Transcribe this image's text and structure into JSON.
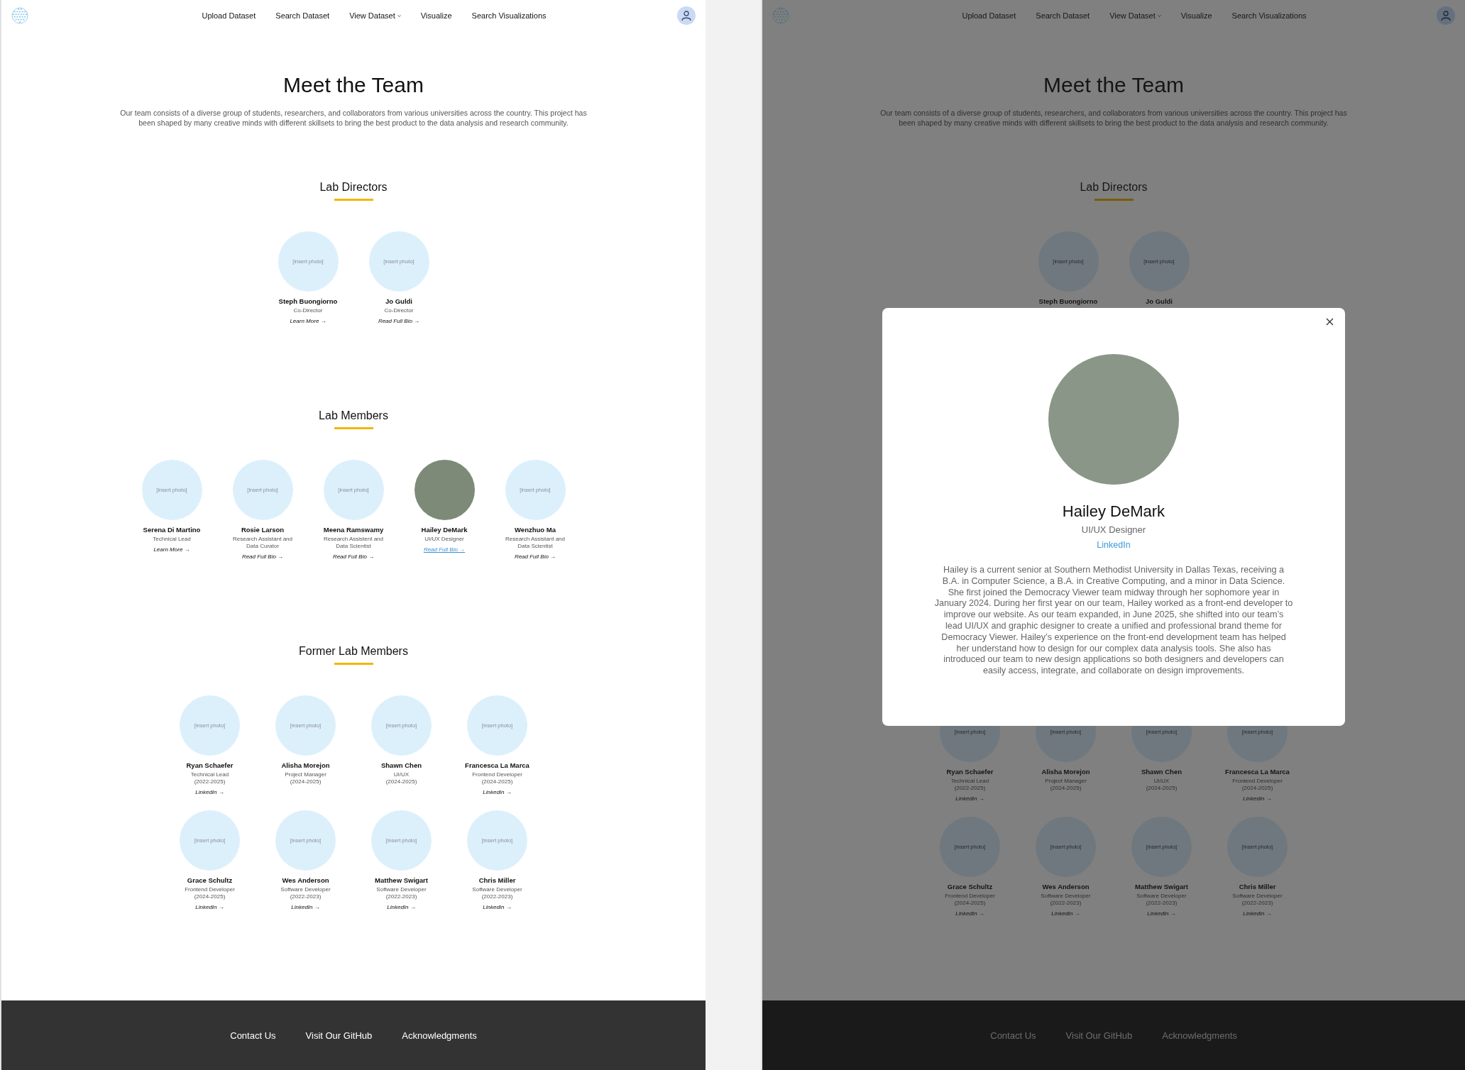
{
  "frames": [
    {
      "nav": {
        "links": [
          {
            "label": "Upload Dataset",
            "dropdown": false
          },
          {
            "label": "Search Dataset",
            "dropdown": false
          },
          {
            "label": "View Dataset",
            "dropdown": true
          },
          {
            "label": "Visualize",
            "dropdown": false
          },
          {
            "label": "Search Visualizations",
            "dropdown": false
          }
        ]
      },
      "title": "Meet the Team",
      "intro": "Our team consists of a diverse group of students, researchers, and collaborators from various universities across the country. This project has been shaped by many creative minds with different skillsets to bring the best product to the data analysis and research community.",
      "sections": [
        {
          "heading": "Lab Directors",
          "members": [
            {
              "photo": {
                "kind": "placeholder",
                "label": "[insert photo]"
              },
              "name": "Steph Buongiorno",
              "role": "Co-Director",
              "link": "Learn More →",
              "link_active": false
            },
            {
              "photo": {
                "kind": "placeholder",
                "label": "[insert photo]"
              },
              "name": "Jo Guldi",
              "role": "Co-Director",
              "link": "Read Full Bio →",
              "link_active": false
            }
          ]
        },
        {
          "heading": "Lab Members",
          "members": [
            {
              "photo": {
                "kind": "placeholder",
                "label": "[insert photo]"
              },
              "name": "Serena Di Martino",
              "role": "Technical Lead",
              "link": "Learn More →",
              "link_active": false
            },
            {
              "photo": {
                "kind": "placeholder",
                "label": "[insert photo]"
              },
              "name": "Rosie Larson",
              "role": "Research Assistant and Data Curator",
              "link": "Read Full Bio →",
              "link_active": false
            },
            {
              "photo": {
                "kind": "placeholder",
                "label": "[insert photo]"
              },
              "name": "Meena Ramswamy",
              "role": "Research Assistent and Data Scientist",
              "link": "Read Full Bio →",
              "link_active": false
            },
            {
              "photo": {
                "kind": "photo"
              },
              "name": "Hailey DeMark",
              "role": "UI/UX Designer",
              "link": "Read Full Bio →",
              "link_active": true
            },
            {
              "photo": {
                "kind": "placeholder",
                "label": "[insert photo]"
              },
              "name": "Wenzhuo Ma",
              "role": "Research Assistant and Data Scientist",
              "link": "Read Full Bio →",
              "link_active": false
            }
          ]
        },
        {
          "heading": "Former Lab Members",
          "members": [
            {
              "photo": {
                "kind": "placeholder",
                "label": "[insert photo]"
              },
              "name": "Ryan Schaefer",
              "role": "Technical Lead",
              "years": "(2022-2025)",
              "link": "LinkedIn →",
              "link_active": false
            },
            {
              "photo": {
                "kind": "placeholder",
                "label": "[insert photo]"
              },
              "name": "Alisha Morejon",
              "role": "Project Manager",
              "years": "(2024-2025)"
            },
            {
              "photo": {
                "kind": "placeholder",
                "label": "[insert photo]"
              },
              "name": "Shawn Chen",
              "role": "UI/UX",
              "years": "(2024-2025)"
            },
            {
              "photo": {
                "kind": "placeholder",
                "label": "[insert photo]"
              },
              "name": "Francesca La Marca",
              "role": "Frontend Developer",
              "years": "(2024-2025)",
              "link": "LinkedIn →",
              "link_active": false
            },
            {
              "photo": {
                "kind": "placeholder",
                "label": "[insert photo]"
              },
              "name": "Grace Schultz",
              "role": "Frontend Developer",
              "years": "(2024-2025)",
              "link": "LinkedIn →",
              "link_active": false
            },
            {
              "photo": {
                "kind": "placeholder",
                "label": "[insert photo]"
              },
              "name": "Wes Anderson",
              "role": "Software Developer",
              "years": "(2022-2023)",
              "link": "LinkedIn →",
              "link_active": false
            },
            {
              "photo": {
                "kind": "placeholder",
                "label": "[insert photo]"
              },
              "name": "Matthew Swigart",
              "role": "Software Developer",
              "years": "(2022-2023)",
              "link": "LinkedIn →",
              "link_active": false
            },
            {
              "photo": {
                "kind": "placeholder",
                "label": "[insert photo]"
              },
              "name": "Chris Miller",
              "role": "Software Developer",
              "years": "(2022-2023)",
              "link": "LinkedIn →",
              "link_active": false
            }
          ]
        }
      ],
      "footer": {
        "links": [
          "Contact Us",
          "Visit Our GitHub",
          "Acknowledgments"
        ]
      }
    },
    {
      "nav": {
        "links": [
          {
            "label": "Upload Dataset",
            "dropdown": false
          },
          {
            "label": "Search Dataset",
            "dropdown": false
          },
          {
            "label": "View Dataset",
            "dropdown": true
          },
          {
            "label": "Visualize",
            "dropdown": false
          },
          {
            "label": "Search Visualizations",
            "dropdown": false
          }
        ]
      },
      "title": "Meet the Team",
      "intro": "Our team consists of a diverse group of students, researchers, and collaborators from various universities across the country. This project has been shaped by many creative minds with different skillsets to bring the best product to the data analysis and research community.",
      "sections": [
        {
          "heading": "Lab Directors",
          "members": [
            {
              "photo": {
                "kind": "placeholder",
                "label": "[insert photo]"
              },
              "name": "Steph Buongiorno"
            },
            {
              "photo": {
                "kind": "placeholder",
                "label": "[insert photo]"
              },
              "name": "Jo Guldi"
            }
          ]
        },
        {
          "members": [
            {
              "photo": {
                "kind": "placeholder",
                "label": "[insert photo]"
              },
              "name": "Ryan Schaefer",
              "role": "Technical Lead",
              "years": "(2022-2025)",
              "link": "LinkedIn →",
              "link_active": false
            },
            {
              "photo": {
                "kind": "placeholder",
                "label": "[insert photo]"
              },
              "name": "Alisha Morejon",
              "role": "Project Manager",
              "years": "(2024-2025)"
            },
            {
              "photo": {
                "kind": "placeholder",
                "label": "[insert photo]"
              },
              "name": "Shawn Chen",
              "role": "UI/UX",
              "years": "(2024-2025)"
            },
            {
              "photo": {
                "kind": "placeholder",
                "label": "[insert photo]"
              },
              "name": "Francesca La Marca",
              "role": "Frontend Developer",
              "years": "(2024-2025)",
              "link": "LinkedIn →",
              "link_active": false
            },
            {
              "photo": {
                "kind": "placeholder",
                "label": "[insert photo]"
              },
              "name": "Grace Schultz",
              "role": "Frontend Developer",
              "years": "(2024-2025)",
              "link": "LinkedIn →",
              "link_active": false
            },
            {
              "photo": {
                "kind": "placeholder",
                "label": "[insert photo]"
              },
              "name": "Wes Anderson",
              "role": "Software Developer",
              "years": "(2022-2023)",
              "link": "LinkedIn →",
              "link_active": false
            },
            {
              "photo": {
                "kind": "placeholder",
                "label": "[insert photo]"
              },
              "name": "Matthew Swigart",
              "role": "Software Developer",
              "years": "(2022-2023)",
              "link": "LinkedIn →",
              "link_active": false
            },
            {
              "photo": {
                "kind": "placeholder",
                "label": "[insert photo]"
              },
              "name": "Chris Miller",
              "role": "Software Developer",
              "years": "(2022-2023)",
              "link": "LinkedIn →",
              "link_active": false
            }
          ]
        }
      ],
      "modal": {
        "name": "Hailey DeMark",
        "role": "UI/UX Designer",
        "link": "LinkedIn",
        "bio": "Hailey is a current senior at Southern Methodist University in Dallas Texas, receiving a B.A. in Computer Science, a B.A. in Creative Computing, and a minor in Data Science. She first joined the Democracy Viewer team midway through her sophomore year in January 2024. During her first year on our team, Hailey worked as a front-end developer to improve our website. As our team expanded, in June 2025, she shifted into our team’s lead UI/UX and graphic designer to create a unified and professional brand theme for Democracy Viewer. Hailey’s experience on the front-end development team has helped her understand how to design for our complex data analysis tools. She also has introduced our team to new design applications so both designers and developers can easily access, integrate, and collaborate on design improvements."
      },
      "footer": {
        "links": [
          "Contact Us",
          "Visit Our GitHub",
          "Acknowledgments"
        ]
      }
    }
  ]
}
